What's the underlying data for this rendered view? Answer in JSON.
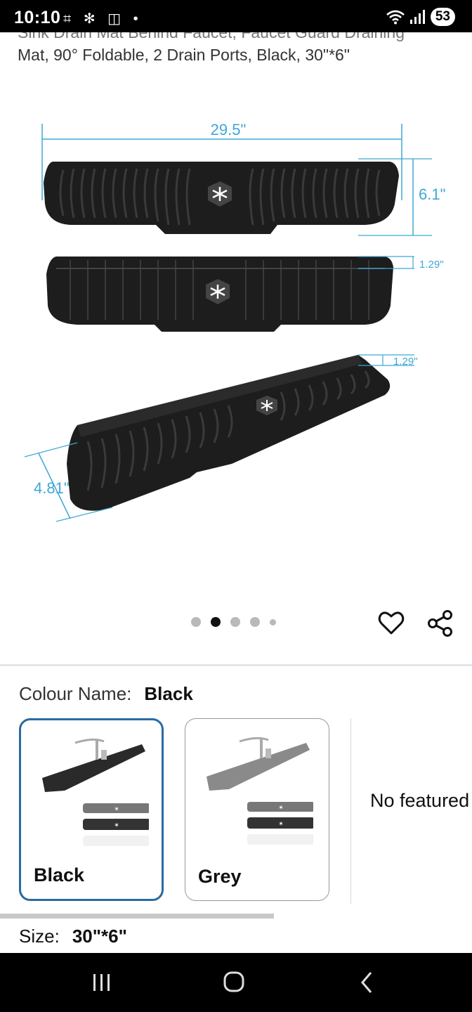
{
  "status_bar": {
    "time": "10:10",
    "left_icons": "⌗ ✻ ◫ •",
    "battery": "53"
  },
  "product": {
    "title_clipped": "Sink Drain Mat Behind Faucet, Faucet Guard Draining",
    "title_line": "Mat, 90° Foldable, 2 Drain Ports, Black, 30\"*6\""
  },
  "hero_image": {
    "dimensions": {
      "width": "29.5\"",
      "height": "6.1\"",
      "thickness_top": "1.29\"",
      "thickness_side": "1.29\"",
      "depth": "4.81\""
    },
    "accent_color": "#3fa7d6"
  },
  "carousel": {
    "count": 5,
    "active_index": 1
  },
  "colour": {
    "key": "Colour Name:",
    "value": "Black",
    "options": [
      {
        "label": "Black"
      },
      {
        "label": "Grey"
      }
    ],
    "no_offers": "No featured offers"
  },
  "size": {
    "key": "Size:",
    "value": "30\"*6\""
  },
  "icons": {
    "wishlist": "heart-icon",
    "share": "share-icon",
    "nav": [
      "recent-apps-icon",
      "home-icon",
      "back-icon"
    ]
  }
}
